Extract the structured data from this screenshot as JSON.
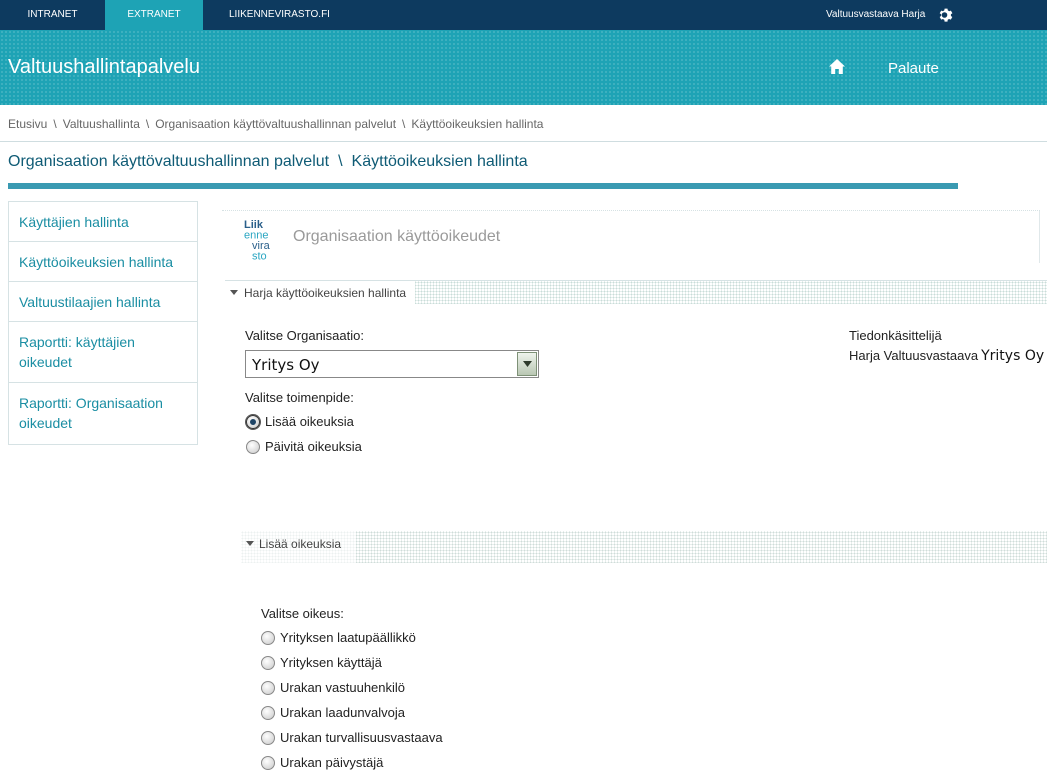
{
  "topnav": {
    "tabs": [
      {
        "label": "INTRANET"
      },
      {
        "label": "EXTRANET"
      },
      {
        "label": "LIIKENNEVIRASTO.FI"
      }
    ],
    "user": "Valtuusvastaava Harja"
  },
  "banner": {
    "title": "Valtuushallintapalvelu",
    "feedback": "Palaute"
  },
  "breadcrumb": [
    "Etusivu",
    "Valtuushallinta",
    "Organisaation käyttövaltuushallinnan palvelut",
    "Käyttöoikeuksien hallinta"
  ],
  "page_heading": {
    "part1": "Organisaation käyttövaltuushallinnan palvelut",
    "part2": "Käyttöoikeuksien hallinta"
  },
  "sidebar": {
    "items": [
      {
        "label": "Käyttäjien hallinta"
      },
      {
        "label": "Käyttöoikeuksien hallinta"
      },
      {
        "label": "Valtuustilaajien hallinta"
      },
      {
        "label": "Raportti: käyttäjien oikeudet"
      },
      {
        "label": "Raportti: Organisaation oikeudet"
      }
    ]
  },
  "panel": {
    "logo_lines": [
      "Liik",
      "enne",
      "vira",
      "sto"
    ],
    "title": "Organisaation käyttöoikeudet",
    "section1_title": "Harja käyttöoikeuksien hallinta",
    "org_label": "Valitse Organisaatio:",
    "org_value": "Yritys Oy",
    "action_label": "Valitse toimenpide:",
    "actions": [
      {
        "label": "Lisää oikeuksia",
        "selected": true
      },
      {
        "label": "Päivitä oikeuksia",
        "selected": false
      }
    ],
    "handler_label": "Tiedonkäsittelijä",
    "handler_name": "Harja Valtuusvastaava",
    "handler_company": "Yritys Oy",
    "section2_title": "Lisää oikeuksia",
    "rights_label": "Valitse oikeus:",
    "rights": [
      {
        "label": "Yrityksen laatupäällikkö"
      },
      {
        "label": "Yrityksen käyttäjä"
      },
      {
        "label": "Urakan vastuuhenkilö"
      },
      {
        "label": "Urakan laadunvalvoja"
      },
      {
        "label": "Urakan turvallisuusvastaava"
      },
      {
        "label": "Urakan päivystäjä"
      }
    ]
  },
  "colors": {
    "topbar": "#0d3a5f",
    "accent": "#1ea3b5",
    "heading": "#0f5b75",
    "link": "#1a8ea3"
  }
}
